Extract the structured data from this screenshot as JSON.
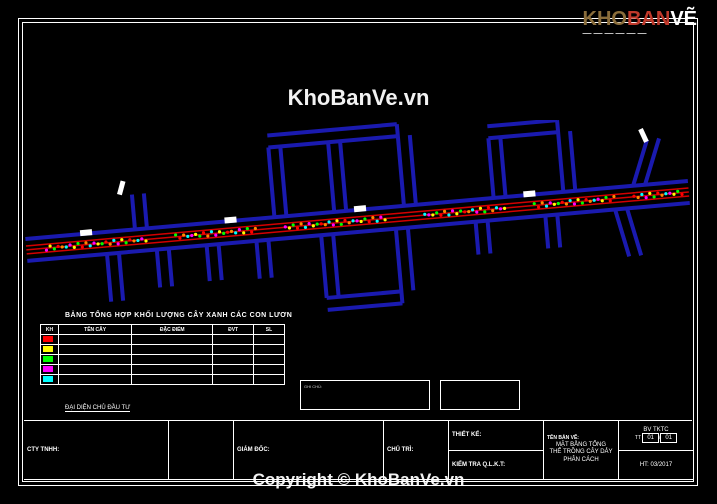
{
  "logo": {
    "p1": "KHO",
    "p2": "BAN",
    "p3": "VẼ",
    "tag": "——————"
  },
  "watermark": "KhoBanVe.vn",
  "copyright": "Copyright © KhoBanVe.vn",
  "qty": {
    "title": "BẢNG TỔNG HỢP KHỐI LƯỢNG CÂY XANH CÁC CON LƯƠN",
    "headers": [
      "KH",
      "TÊN CÂY",
      "ĐẶC ĐIỂM",
      "ĐVT",
      "SL"
    ],
    "rows": [
      {
        "color": "#ff0000",
        "name": "",
        "spec": "",
        "unit": "",
        "qty": ""
      },
      {
        "color": "#ffff00",
        "name": "",
        "spec": "",
        "unit": "",
        "qty": ""
      },
      {
        "color": "#00ff00",
        "name": "",
        "spec": "",
        "unit": "",
        "qty": ""
      },
      {
        "color": "#ff00ff",
        "name": "",
        "spec": "",
        "unit": "",
        "qty": ""
      },
      {
        "color": "#00ffff",
        "name": "",
        "spec": "",
        "unit": "",
        "qty": ""
      }
    ]
  },
  "notes1": "GHI CHÚ:",
  "notes2": "",
  "investor_label": "ĐẠI DIỆN CHỦ ĐẦU TƯ",
  "titleblock": {
    "c1a": "",
    "c1b": "CTY TNHH:",
    "c2a": "",
    "c2b": "",
    "c3a": "GIÁM ĐỐC:",
    "c3b": "",
    "c4a": "",
    "c4b": "CHỦ TRÌ:",
    "c5a": "THIẾT KẾ:",
    "c5b": "KIỂM TRA Q.L.K.T:",
    "title_label": "TÊN BẢN VẼ:",
    "title_line1": "MẶT BẰNG TỔNG",
    "title_line2": "THỂ TRỒNG CÂY DẢY",
    "title_line3": "PHÂN CÁCH",
    "sheet": "BV TKTC",
    "sheet_no_label": "TT",
    "sheet_no": "01",
    "sheet_total": "01",
    "date_label": "HT:",
    "date": "03/2017"
  },
  "roads": {
    "blue": "#1a1aaf",
    "red": "#d40000",
    "white": "#ffffff",
    "veg_colors": [
      "#ffff00",
      "#00ff00",
      "#ff0000",
      "#ff8800",
      "#00ffff",
      "#ff00ff"
    ]
  }
}
